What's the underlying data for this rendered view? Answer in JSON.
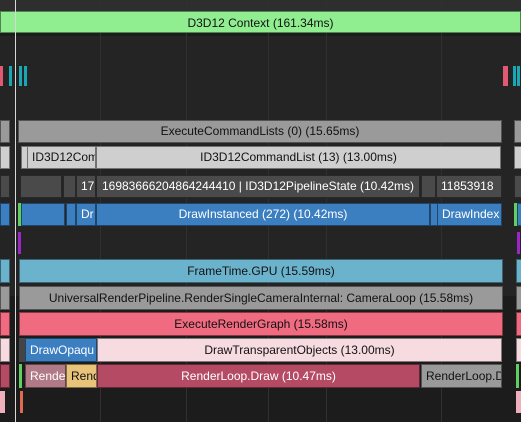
{
  "context": {
    "label": "D3D12 Context (161.34ms)",
    "color": "#90ee90"
  },
  "cmd_lists": {
    "execute": "ExecuteCommandLists (0) (15.65ms)",
    "list_left": "ID3D12Com",
    "list_main": "ID3D12CommandList (13) (13.00ms)"
  },
  "pipeline": {
    "left": "17",
    "main": "16983666204864244410 | ID3D12PipelineState (10.42ms)",
    "right": "11853918"
  },
  "draw": {
    "left_frag": "Dr",
    "main": "DrawInstanced (272) (10.42ms)",
    "right": "DrawIndex"
  },
  "gpu": {
    "frame_time": "FrameTime.GPU (15.59ms)",
    "camera_loop": "UniversalRenderPipeline.RenderSingleCameraInternal: CameraLoop (15.58ms)",
    "execute_graph": "ExecuteRenderGraph (15.58ms)",
    "draw_opaque": "DrawOpaqu",
    "draw_transparent": "DrawTransparentObjects (13.00ms)",
    "render_frag_a": "Rende",
    "render_frag_b": "Rend",
    "render_loop": "RenderLoop.Draw (10.47ms)",
    "render_loop_right": "RenderLoop.D"
  },
  "colors": {
    "background": "#1c1c1c",
    "context_green": "#90ee90",
    "light_gray": "#cfcfcf",
    "mid_gray": "#9a9a9a",
    "dark_gray": "#4a4a4a",
    "draw_blue": "#3b7fc1",
    "frame_teal": "#6bb3cc",
    "graph_pink": "#f06a80",
    "transparent_pink": "#f6dbe0",
    "loop_maroon": "#b44a63",
    "tan": "#e8c47a",
    "purple_marker": "#9b27c8"
  }
}
